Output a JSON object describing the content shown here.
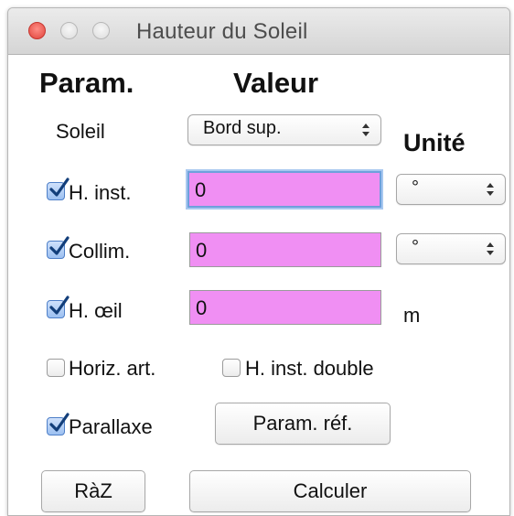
{
  "window": {
    "title": "Hauteur du Soleil"
  },
  "headers": {
    "param": "Param.",
    "valeur": "Valeur",
    "unite": "Unité"
  },
  "soleil": {
    "label": "Soleil",
    "selected": "Bord sup."
  },
  "rows": {
    "h_inst": {
      "label": "H. inst.",
      "checked": true,
      "value": "0",
      "unit": "°"
    },
    "collim": {
      "label": "Collim.",
      "checked": true,
      "value": "0",
      "unit": "°"
    },
    "h_oeil": {
      "label": "H. œil",
      "checked": true,
      "value": "0",
      "unit": "m"
    }
  },
  "options": {
    "horiz_art": {
      "label": "Horiz. art.",
      "checked": false
    },
    "h_inst_double": {
      "label": "H. inst. double",
      "checked": false
    },
    "parallaxe": {
      "label": "Parallaxe",
      "checked": true
    }
  },
  "buttons": {
    "param_ref": "Param. réf.",
    "raz": "RàZ",
    "calculer": "Calculer"
  },
  "colors": {
    "field_fill": "#f08ff3",
    "focus_ring": "#6ea0dc",
    "checkbox_checked": "#9cc0f1",
    "close_button": "#e0443b"
  },
  "icons": {
    "check": "checkmark-icon",
    "stepper": "updown-arrows-icon"
  }
}
